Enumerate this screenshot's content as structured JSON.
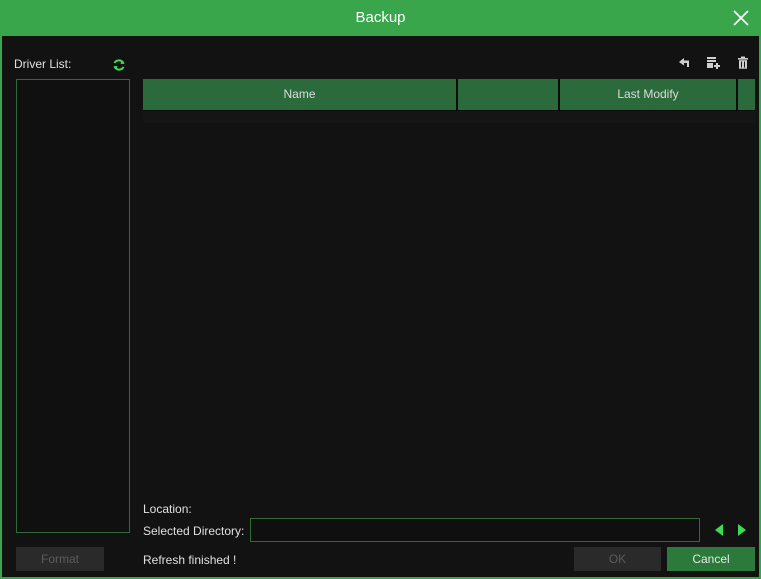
{
  "dialog": {
    "title": "Backup"
  },
  "left_panel": {
    "driver_list_label": "Driver List:",
    "format_button": "Format"
  },
  "toolbar": {
    "icons": [
      "back-icon",
      "new-folder-icon",
      "delete-icon"
    ]
  },
  "file_table": {
    "columns": [
      "Name",
      "",
      "Last Modify",
      ""
    ],
    "rows": []
  },
  "footer": {
    "location_label": "Location:",
    "selected_directory_label": "Selected Directory:",
    "selected_directory_value": "",
    "status": "Refresh finished !",
    "ok_button": "OK",
    "cancel_button": "Cancel"
  },
  "colors": {
    "accent": "#3aa64c",
    "header_bg": "#2b6a3b",
    "arrow": "#3ddc50"
  }
}
